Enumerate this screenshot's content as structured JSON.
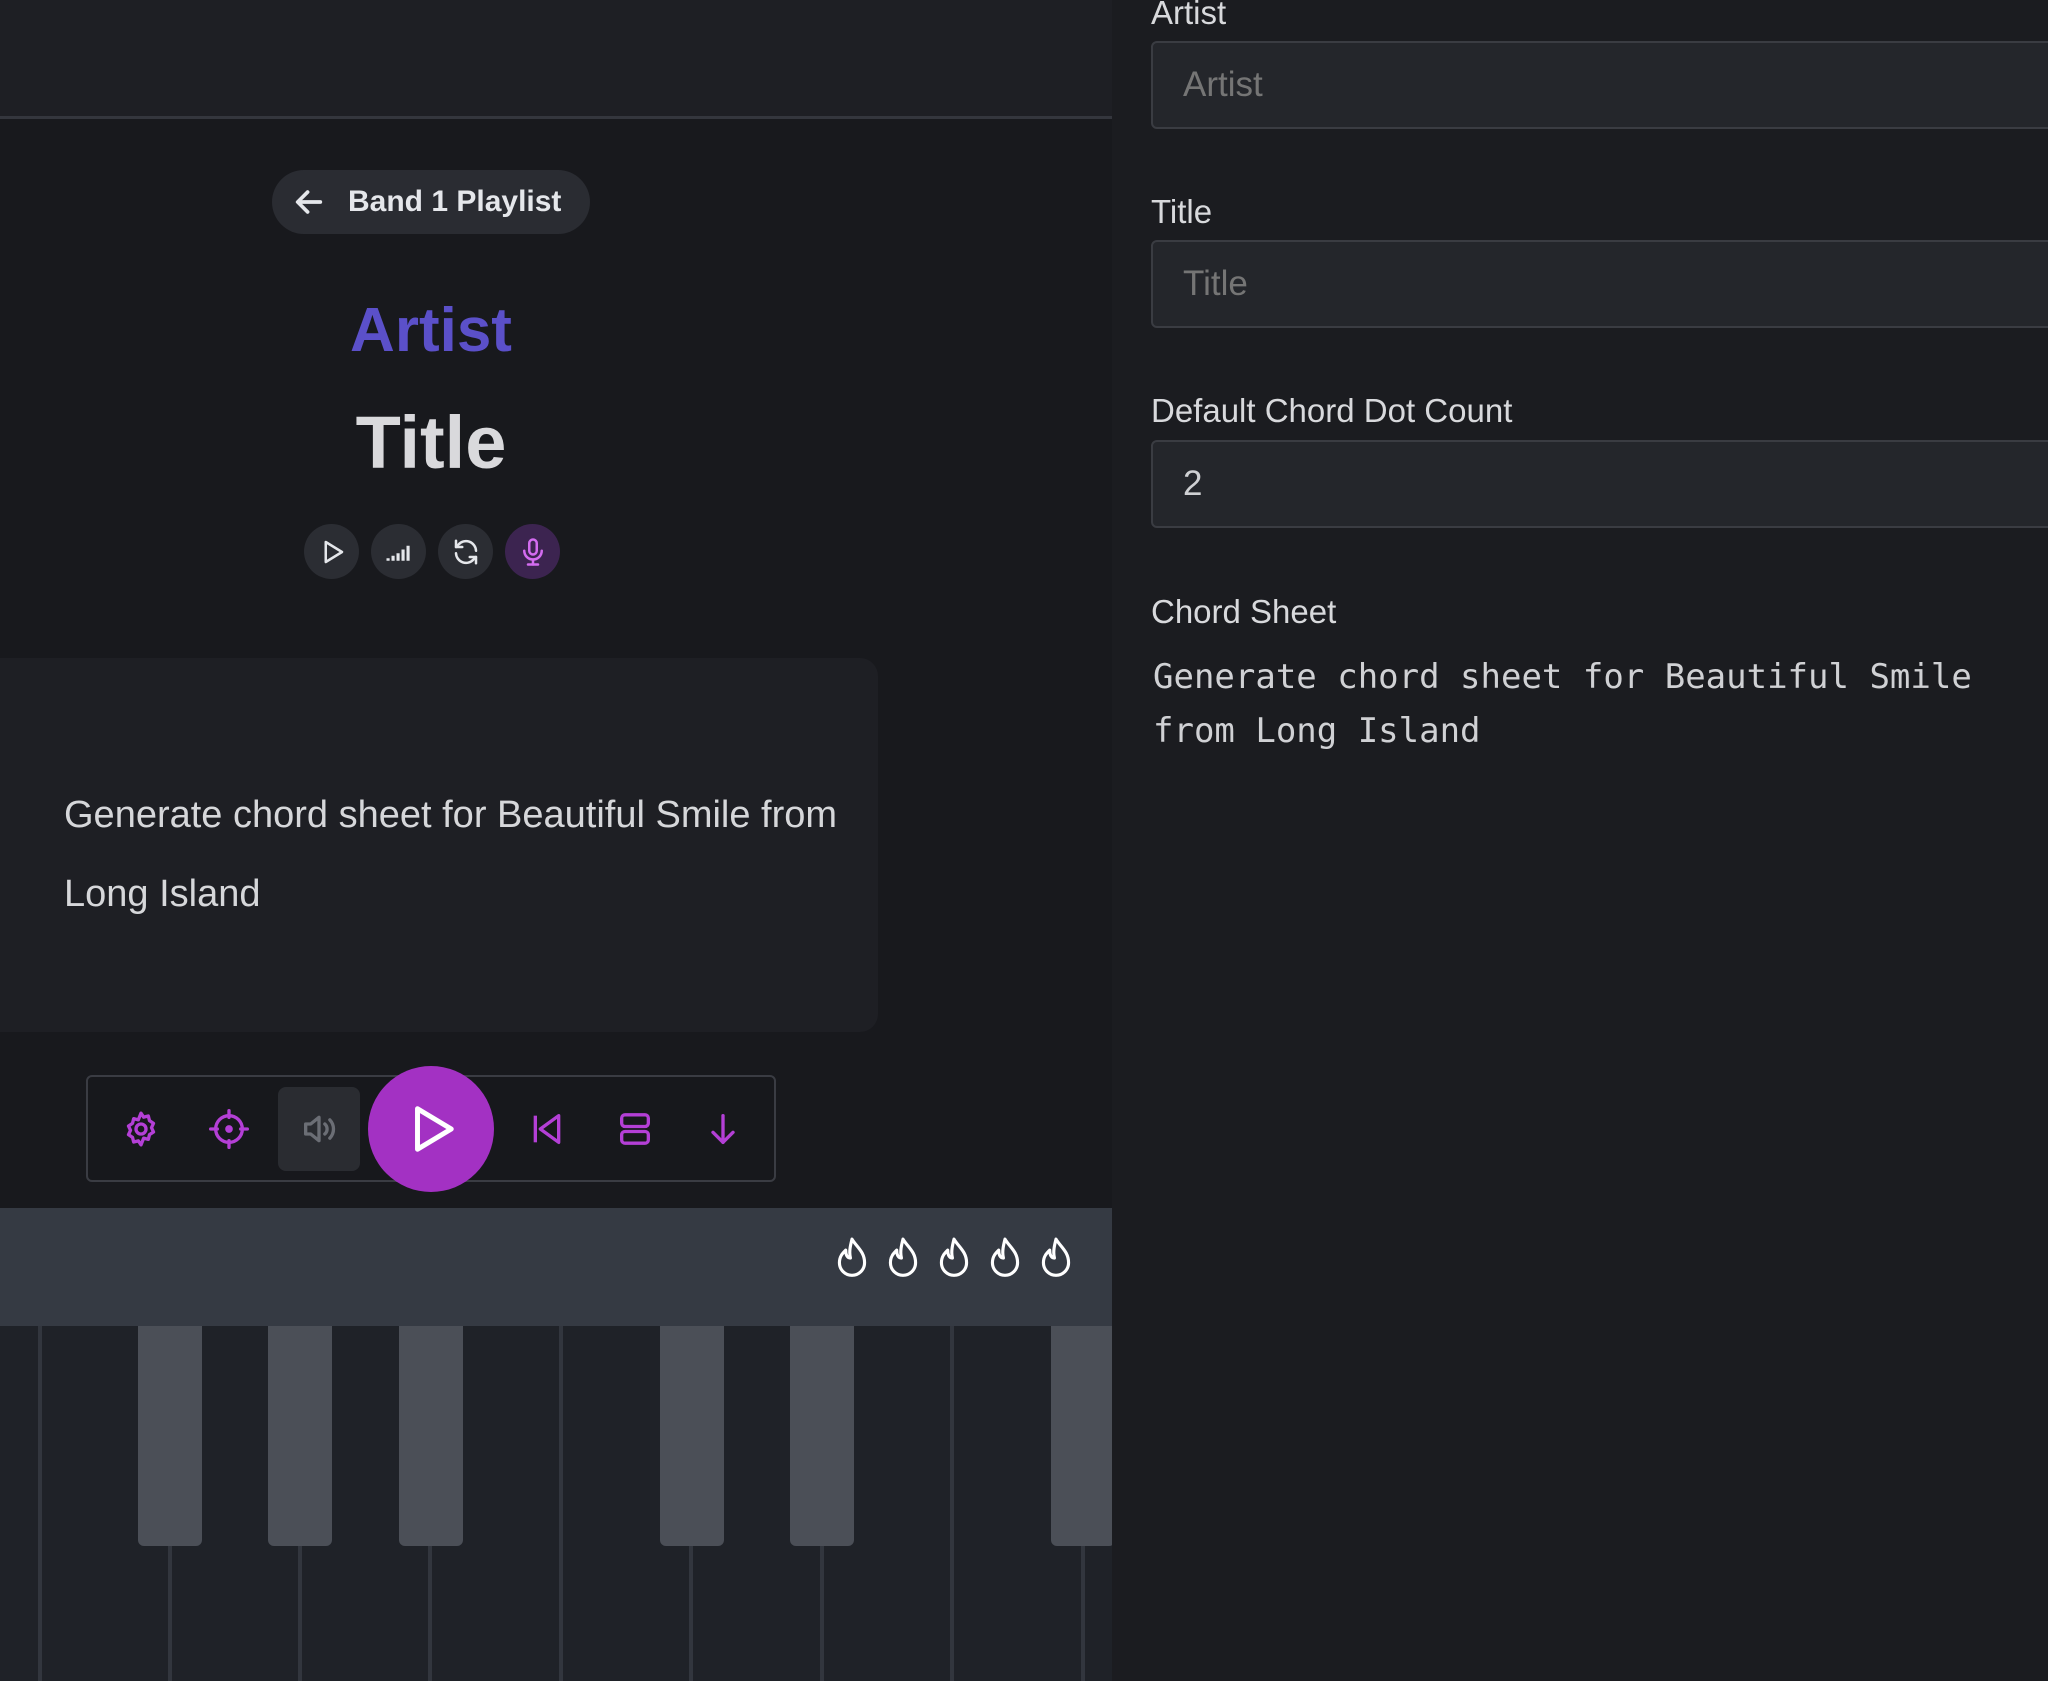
{
  "left": {
    "back_button": {
      "label": "Band 1 Playlist",
      "icon": "arrow-left-icon"
    },
    "song": {
      "artist": "Artist",
      "title": "Title"
    },
    "mini_controls": [
      {
        "icon": "play-icon"
      },
      {
        "icon": "equalizer-icon"
      },
      {
        "icon": "refresh-icon"
      },
      {
        "icon": "microphone-icon"
      }
    ],
    "chord_card": {
      "text": "Generate chord sheet for Beautiful Smile from Long Island"
    },
    "transport": [
      {
        "icon": "settings-gear-icon"
      },
      {
        "icon": "crosshair-icon"
      },
      {
        "icon": "volume-icon"
      },
      {
        "icon": "play-icon"
      },
      {
        "icon": "skip-back-icon"
      },
      {
        "icon": "layout-rows-icon"
      },
      {
        "icon": "arrow-down-icon"
      }
    ],
    "flames": 5
  },
  "right": {
    "artist": {
      "label": "Artist",
      "placeholder": "Artist"
    },
    "title": {
      "label": "Title",
      "placeholder": "Title"
    },
    "dot_count": {
      "label": "Default Chord Dot Count",
      "value": "2"
    },
    "chord_sheet": {
      "label": "Chord Sheet",
      "text": "Generate chord sheet for Beautiful Smile\nfrom Long Island"
    }
  },
  "colors": {
    "accent": "#a331c3",
    "artist_heading": "#5b50c9",
    "background": "#18191d"
  }
}
